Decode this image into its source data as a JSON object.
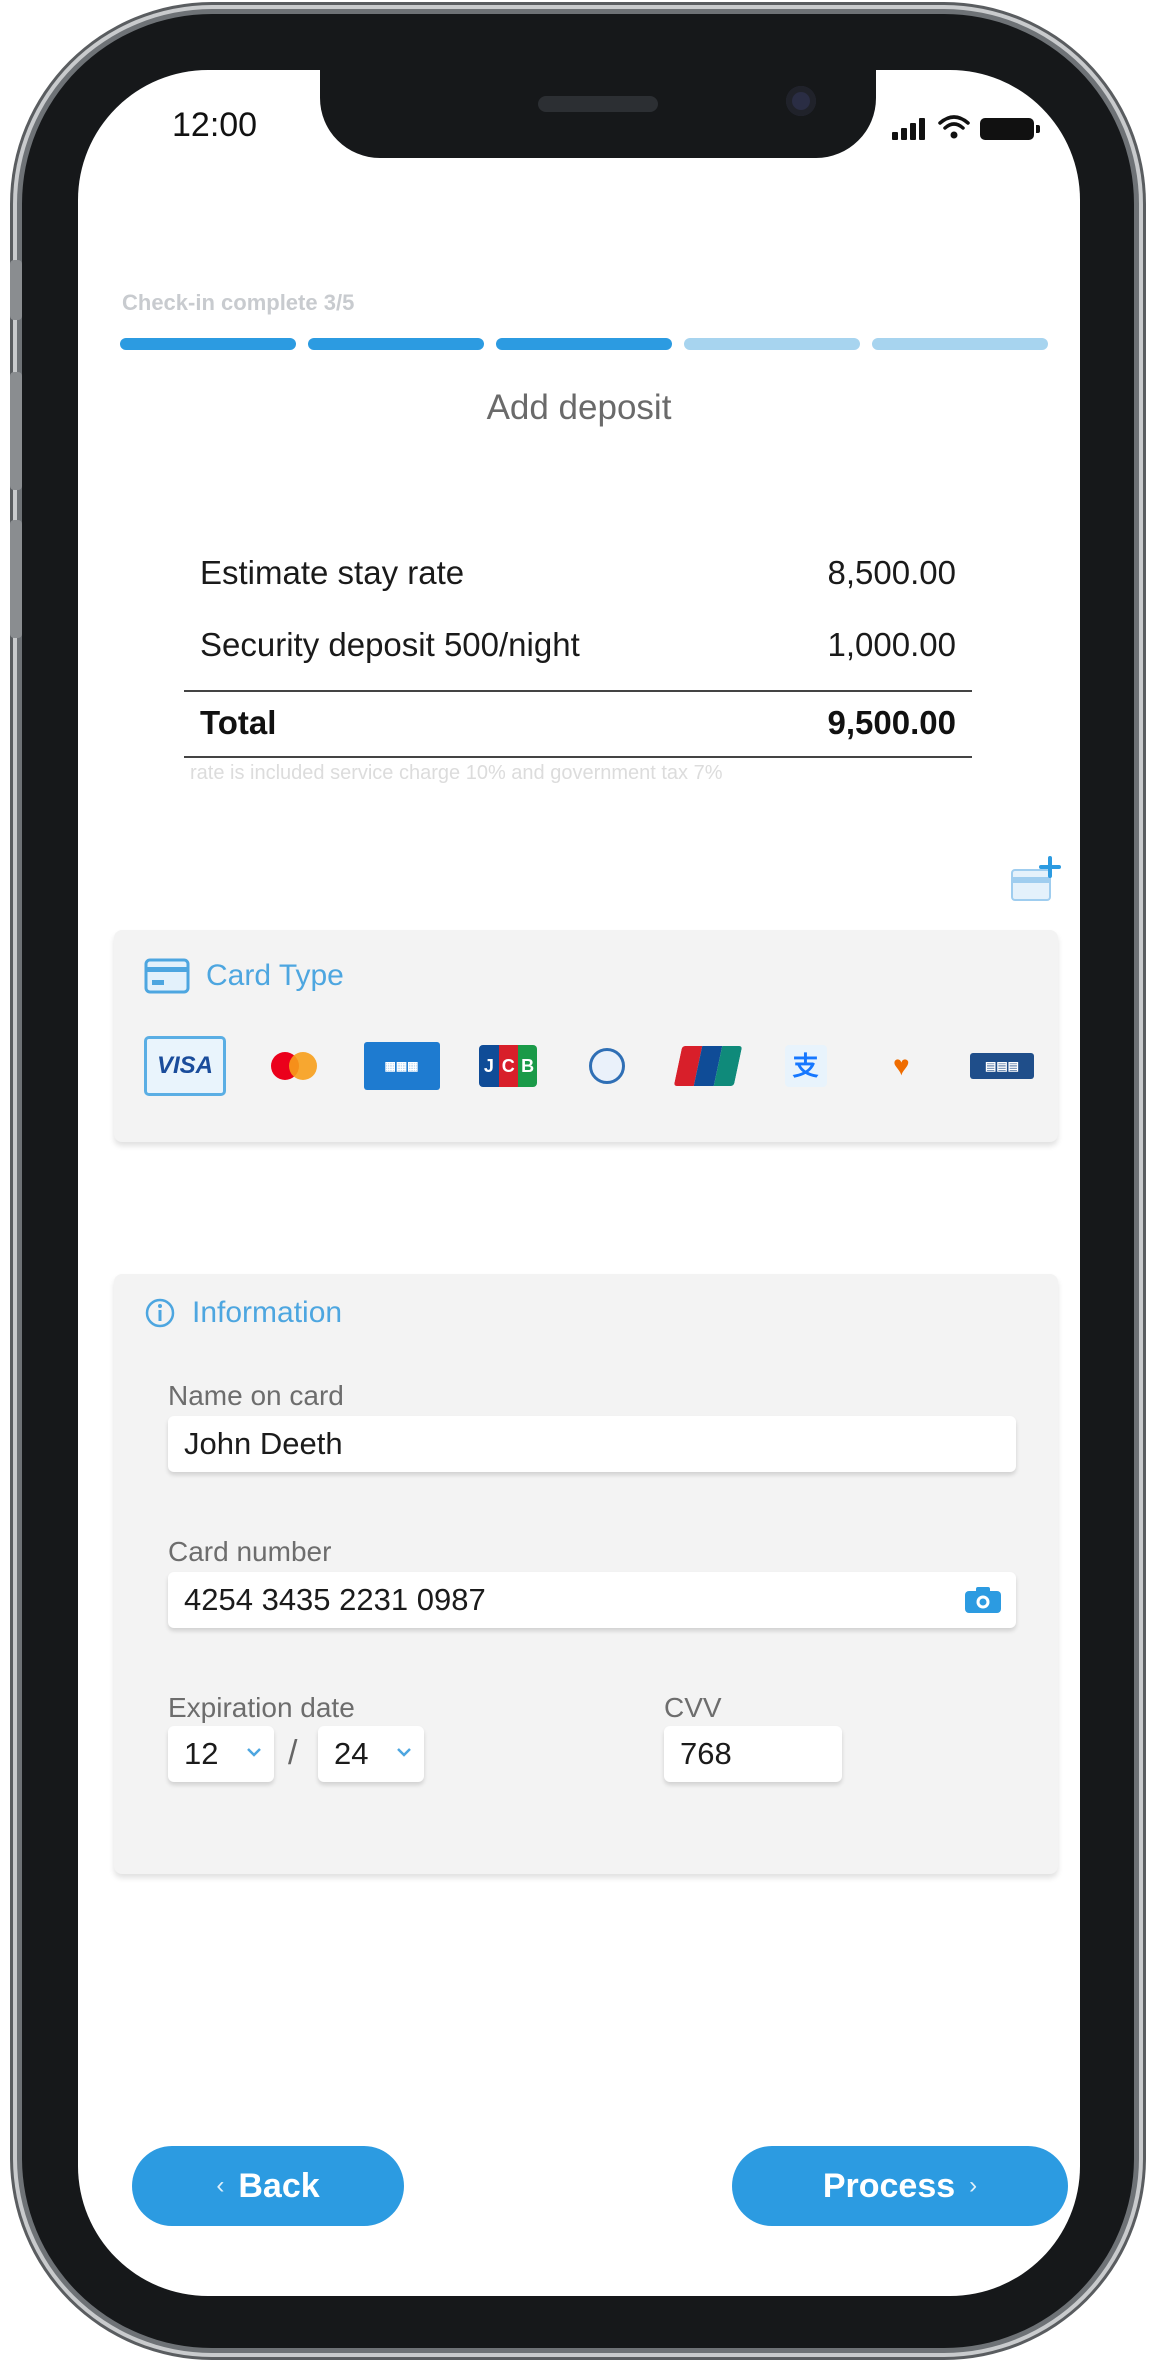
{
  "status_bar": {
    "time": "12:00"
  },
  "progress": {
    "label": "Check-in complete 3/5",
    "completed": 3,
    "total": 5
  },
  "title": "Add deposit",
  "summary": {
    "rows": [
      {
        "label": "Estimate stay rate",
        "value": "8,500.00"
      },
      {
        "label": "Security deposit 500/night",
        "value": "1,000.00"
      }
    ],
    "total": {
      "label": "Total",
      "value": "9,500.00"
    },
    "note": "rate is included service charge 10% and government tax 7%"
  },
  "card_type": {
    "heading": "Card Type",
    "brands": [
      {
        "name": "visa",
        "text": "VISA",
        "selected": true
      },
      {
        "name": "mastercard",
        "selected": false
      },
      {
        "name": "american-express",
        "selected": false
      },
      {
        "name": "jcb",
        "text": "JCB",
        "selected": false
      },
      {
        "name": "diners-club",
        "selected": false
      },
      {
        "name": "unionpay",
        "selected": false
      },
      {
        "name": "alipay",
        "text": "支",
        "selected": false
      },
      {
        "name": "truemoney",
        "selected": false
      },
      {
        "name": "bank-card",
        "selected": false
      }
    ]
  },
  "information": {
    "heading": "Information",
    "name_on_card": {
      "label": "Name on card",
      "value": "John Deeth"
    },
    "card_number": {
      "label": "Card number",
      "value": "4254 3435 2231 0987"
    },
    "expiration": {
      "label": "Expiration date",
      "month": "12",
      "year": "24",
      "separator": "/"
    },
    "cvv": {
      "label": "CVV",
      "value": "768"
    }
  },
  "buttons": {
    "back": "Back",
    "back_arrow": "‹",
    "process": "Process",
    "process_arrow": "›"
  },
  "colors": {
    "accent": "#2c9be1",
    "accent_light": "#a7d4ef",
    "heading_blue": "#4da6e0",
    "panel_bg": "#f3f3f3"
  }
}
